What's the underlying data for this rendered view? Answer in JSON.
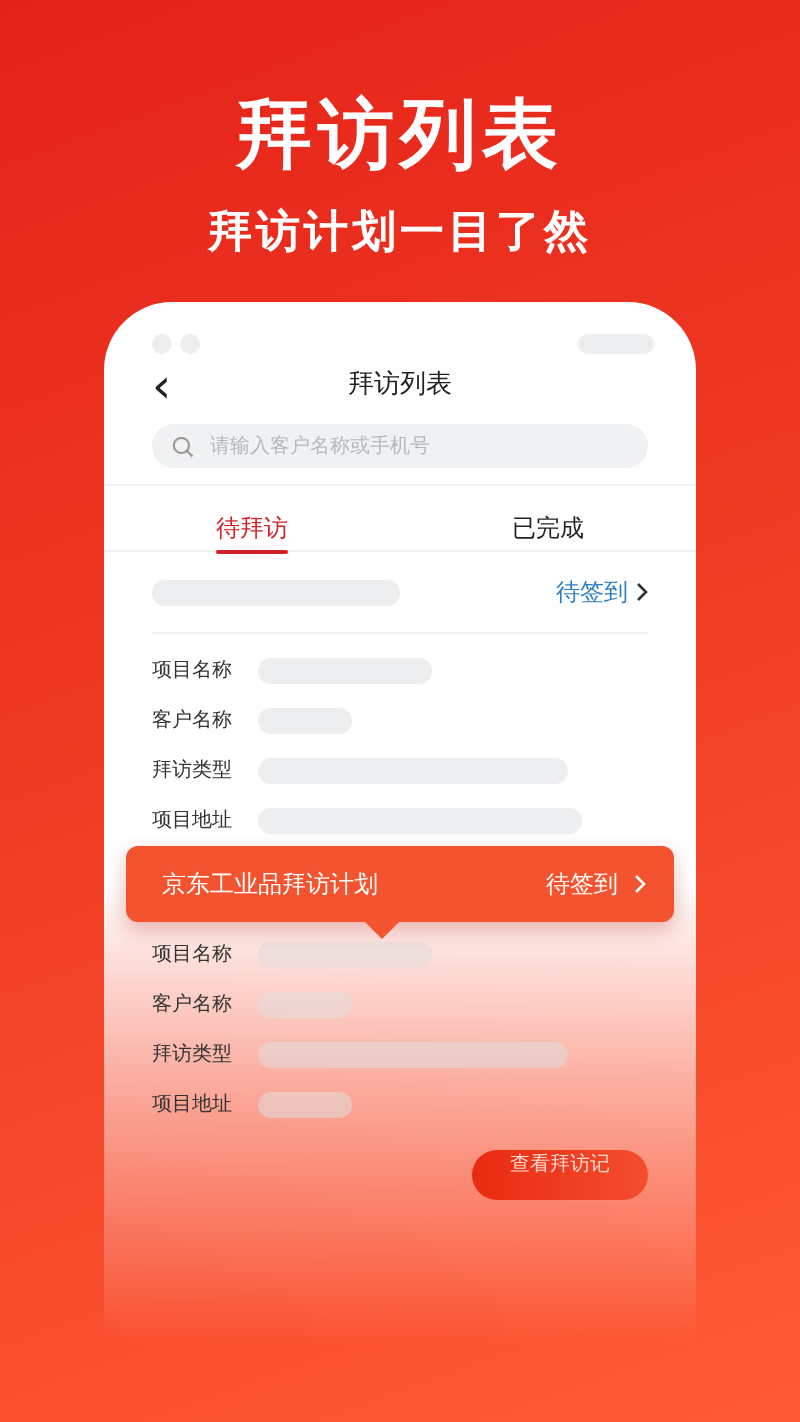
{
  "header": {
    "title": "拜访列表",
    "subtitle": "拜访计划一目了然"
  },
  "phone": {
    "nav_title": "拜访列表",
    "back_icon": "‹",
    "search": {
      "placeholder": "请输入客户名称或手机号"
    },
    "tabs": [
      {
        "label": "待拜访",
        "selected": true
      },
      {
        "label": "已完成",
        "selected": false
      }
    ],
    "visits": [
      {
        "status": "待签到",
        "fields": [
          "项目名称",
          "客户名称",
          "拜访类型",
          "项目地址"
        ]
      },
      {
        "fields": [
          "项目名称",
          "客户名称",
          "拜访类型",
          "项目地址"
        ]
      }
    ],
    "popup": {
      "title": "京东工业品拜访计划",
      "status": "待签到"
    },
    "records_button": "查看拜访记"
  }
}
